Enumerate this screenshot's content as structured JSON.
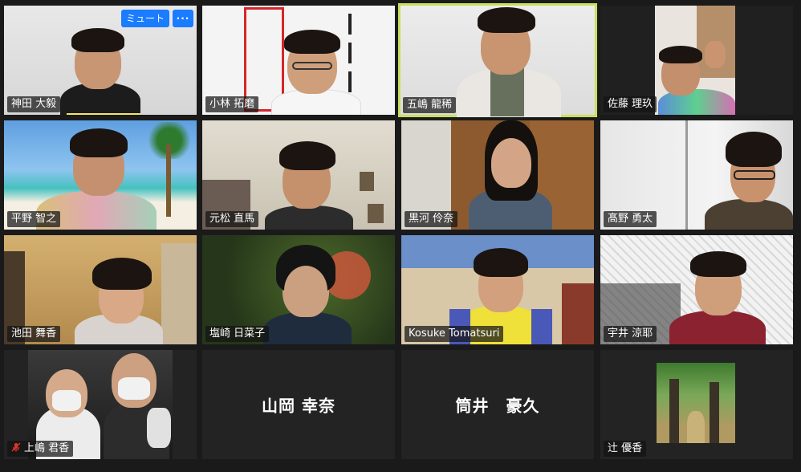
{
  "participants": [
    {
      "name": "神田 大毅",
      "muted": false,
      "show_controls": true
    },
    {
      "name": "小林 拓磨",
      "muted": false
    },
    {
      "name": "五嶋 龍稀",
      "muted": false,
      "active": true
    },
    {
      "name": "佐藤 理玖",
      "muted": false
    },
    {
      "name": "平野 智之",
      "muted": false
    },
    {
      "name": "元松 直馬",
      "muted": false
    },
    {
      "name": "黒河 伶奈",
      "muted": false
    },
    {
      "name": "髙野 勇太",
      "muted": false
    },
    {
      "name": "池田 舞香",
      "muted": false
    },
    {
      "name": "塩崎 日菜子",
      "muted": false
    },
    {
      "name": "Kosuke Tomatsuri",
      "muted": false
    },
    {
      "name": "宇井 涼耶",
      "muted": false
    },
    {
      "name": "上嶋 君香",
      "muted": true
    },
    {
      "name": "山岡 幸奈",
      "video_off": true
    },
    {
      "name": "筒井　豪久",
      "video_off": true
    },
    {
      "name": "辻 優香",
      "muted": false
    }
  ],
  "controls": {
    "mute_label": "ミュート",
    "more_label": "···"
  },
  "colors": {
    "background": "#1a1a1a",
    "tile": "#232323",
    "active_border": "#c8e05a",
    "button_blue": "#1a7cff",
    "mute_red": "#e0352b"
  }
}
